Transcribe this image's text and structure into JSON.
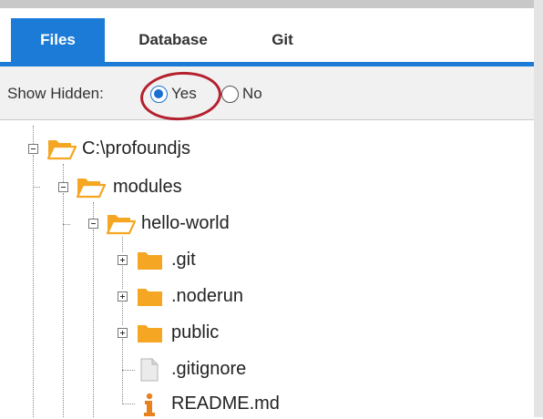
{
  "tabs": [
    {
      "label": "Files",
      "active": true
    },
    {
      "label": "Database",
      "active": false
    },
    {
      "label": "Git",
      "active": false
    }
  ],
  "options": {
    "show_hidden_label": "Show Hidden:",
    "yes_label": "Yes",
    "no_label": "No",
    "selected": "Yes"
  },
  "tree": {
    "root": "C:\\profoundjs",
    "modules": "modules",
    "hello_world": "hello-world",
    "children": [
      {
        "label": ".git",
        "type": "folder",
        "icon": "folder-closed-icon"
      },
      {
        "label": ".noderun",
        "type": "folder",
        "icon": "folder-closed-icon"
      },
      {
        "label": "public",
        "type": "folder",
        "icon": "folder-closed-icon"
      },
      {
        "label": ".gitignore",
        "type": "file",
        "icon": "file-icon"
      },
      {
        "label": "README.md",
        "type": "file",
        "icon": "info-icon"
      }
    ]
  },
  "colors": {
    "accent": "#1b7bd6",
    "folder": "#f5a623",
    "highlight": "#b4202e",
    "info": "#e8821e"
  }
}
